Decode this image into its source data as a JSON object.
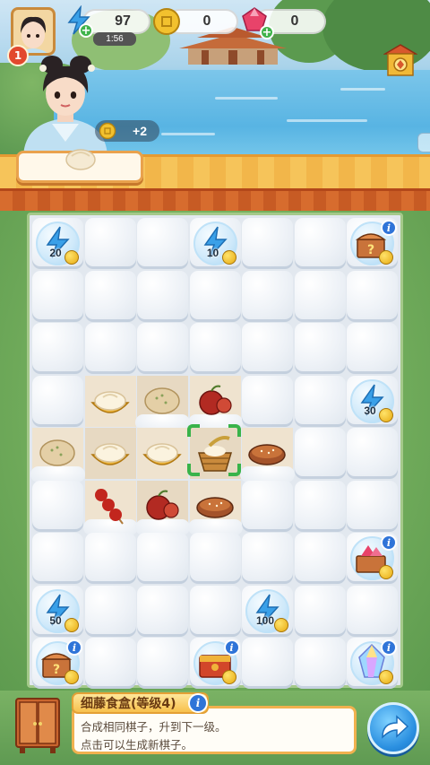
{
  "hud": {
    "energy": "97",
    "energy_timer": "1:56",
    "coins": "0",
    "gems": "0",
    "player_level": "1",
    "coin_reward": "+2"
  },
  "board": {
    "rows": 9,
    "cols": 7,
    "cells": [
      {
        "r": 0,
        "c": 0,
        "kind": "bubble",
        "item": "energy",
        "label": "20"
      },
      {
        "r": 0,
        "c": 1,
        "kind": "fog"
      },
      {
        "r": 0,
        "c": 2,
        "kind": "fog"
      },
      {
        "r": 0,
        "c": 3,
        "kind": "bubble",
        "item": "energy",
        "label": "10"
      },
      {
        "r": 0,
        "c": 4,
        "kind": "fog"
      },
      {
        "r": 0,
        "c": 5,
        "kind": "fog"
      },
      {
        "r": 0,
        "c": 6,
        "kind": "bubble",
        "item": "mystery-chest",
        "info": true
      },
      {
        "r": 1,
        "c": 0,
        "kind": "fog"
      },
      {
        "r": 1,
        "c": 1,
        "kind": "fog"
      },
      {
        "r": 1,
        "c": 2,
        "kind": "fog"
      },
      {
        "r": 1,
        "c": 3,
        "kind": "fog"
      },
      {
        "r": 1,
        "c": 4,
        "kind": "fog"
      },
      {
        "r": 1,
        "c": 5,
        "kind": "fog"
      },
      {
        "r": 1,
        "c": 6,
        "kind": "fog"
      },
      {
        "r": 2,
        "c": 0,
        "kind": "fog"
      },
      {
        "r": 2,
        "c": 1,
        "kind": "fog"
      },
      {
        "r": 2,
        "c": 2,
        "kind": "fog"
      },
      {
        "r": 2,
        "c": 3,
        "kind": "fog"
      },
      {
        "r": 2,
        "c": 4,
        "kind": "fog"
      },
      {
        "r": 2,
        "c": 5,
        "kind": "fog"
      },
      {
        "r": 2,
        "c": 6,
        "kind": "fog"
      },
      {
        "r": 3,
        "c": 0,
        "kind": "fog"
      },
      {
        "r": 3,
        "c": 1,
        "kind": "open",
        "item": "steamed-bun"
      },
      {
        "r": 3,
        "c": 2,
        "kind": "open",
        "item": "flatbread",
        "snow": true
      },
      {
        "r": 3,
        "c": 3,
        "kind": "open",
        "item": "hawthorn",
        "snow": true
      },
      {
        "r": 3,
        "c": 4,
        "kind": "fog"
      },
      {
        "r": 3,
        "c": 5,
        "kind": "fog"
      },
      {
        "r": 3,
        "c": 6,
        "kind": "bubble",
        "item": "energy",
        "label": "30"
      },
      {
        "r": 4,
        "c": 0,
        "kind": "open",
        "item": "flatbread",
        "snow": true
      },
      {
        "r": 4,
        "c": 1,
        "kind": "open",
        "item": "steamed-bun"
      },
      {
        "r": 4,
        "c": 2,
        "kind": "open",
        "item": "steamed-bun"
      },
      {
        "r": 4,
        "c": 3,
        "kind": "open",
        "item": "food-basket",
        "selected": true
      },
      {
        "r": 4,
        "c": 4,
        "kind": "open",
        "item": "sesame-cake",
        "snow": true
      },
      {
        "r": 4,
        "c": 5,
        "kind": "fog"
      },
      {
        "r": 4,
        "c": 6,
        "kind": "fog"
      },
      {
        "r": 5,
        "c": 0,
        "kind": "fog"
      },
      {
        "r": 5,
        "c": 1,
        "kind": "open",
        "item": "candied-haws",
        "snow": true
      },
      {
        "r": 5,
        "c": 2,
        "kind": "open",
        "item": "hawthorn",
        "snow": true
      },
      {
        "r": 5,
        "c": 3,
        "kind": "open",
        "item": "sesame-cake",
        "snow": true
      },
      {
        "r": 5,
        "c": 4,
        "kind": "fog"
      },
      {
        "r": 5,
        "c": 5,
        "kind": "fog"
      },
      {
        "r": 5,
        "c": 6,
        "kind": "fog"
      },
      {
        "r": 6,
        "c": 0,
        "kind": "fog"
      },
      {
        "r": 6,
        "c": 1,
        "kind": "fog"
      },
      {
        "r": 6,
        "c": 2,
        "kind": "fog"
      },
      {
        "r": 6,
        "c": 3,
        "kind": "fog"
      },
      {
        "r": 6,
        "c": 4,
        "kind": "fog"
      },
      {
        "r": 6,
        "c": 5,
        "kind": "fog"
      },
      {
        "r": 6,
        "c": 6,
        "kind": "bubble",
        "item": "gem-chest",
        "info": true
      },
      {
        "r": 7,
        "c": 0,
        "kind": "bubble",
        "item": "energy",
        "label": "50"
      },
      {
        "r": 7,
        "c": 1,
        "kind": "fog"
      },
      {
        "r": 7,
        "c": 2,
        "kind": "fog"
      },
      {
        "r": 7,
        "c": 3,
        "kind": "fog"
      },
      {
        "r": 7,
        "c": 4,
        "kind": "bubble",
        "item": "energy",
        "label": "100"
      },
      {
        "r": 7,
        "c": 5,
        "kind": "fog"
      },
      {
        "r": 7,
        "c": 6,
        "kind": "fog"
      },
      {
        "r": 8,
        "c": 0,
        "kind": "bubble",
        "item": "mystery-chest",
        "info": true
      },
      {
        "r": 8,
        "c": 1,
        "kind": "fog"
      },
      {
        "r": 8,
        "c": 2,
        "kind": "fog"
      },
      {
        "r": 8,
        "c": 3,
        "kind": "bubble",
        "item": "red-chest",
        "info": true
      },
      {
        "r": 8,
        "c": 4,
        "kind": "fog"
      },
      {
        "r": 8,
        "c": 5,
        "kind": "fog"
      },
      {
        "r": 8,
        "c": 6,
        "kind": "bubble",
        "item": "crystal",
        "info": true
      }
    ]
  },
  "item_panel": {
    "title": "细藤食盒(等级4)",
    "line1": "合成相同棋子，升到下一级。",
    "line2": "点击可以生成新棋子。"
  },
  "colors": {
    "energy": "#3aa0e8",
    "coin": "#f2c12e",
    "gem": "#e8436a",
    "select": "#39b34a",
    "info": "#2f74d8"
  }
}
